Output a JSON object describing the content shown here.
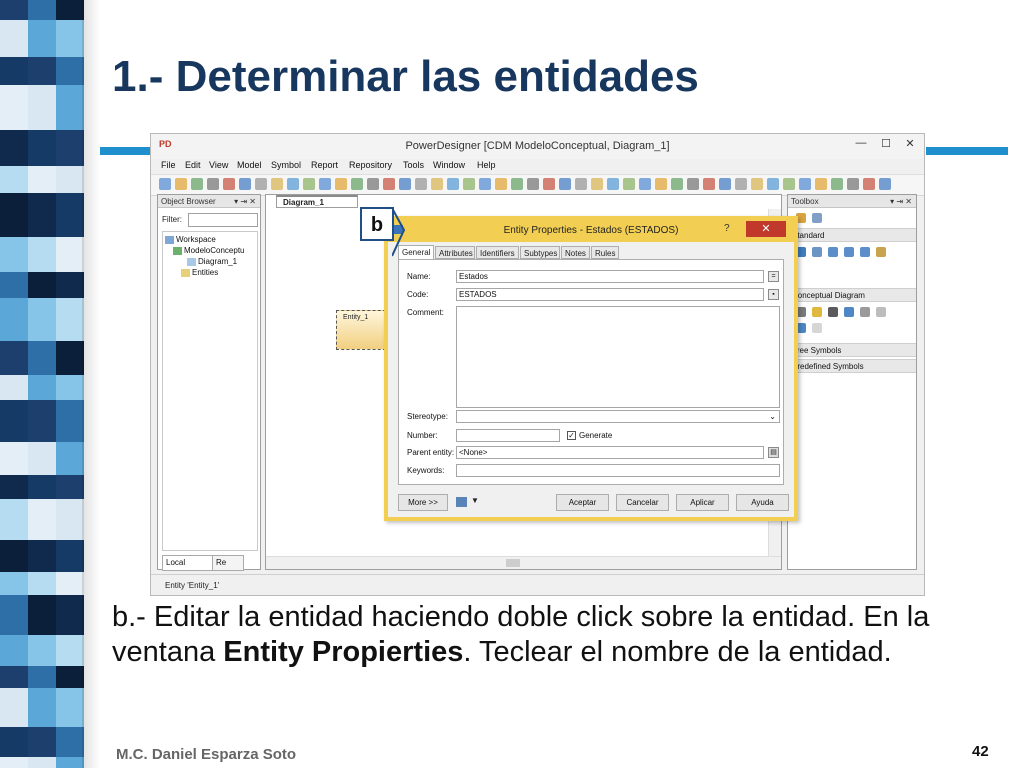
{
  "slide": {
    "title": "1.- Determinar las entidades",
    "caption_part1": "b.- Editar la entidad haciendo doble click sobre la entidad. En la ventana ",
    "caption_bold": "Entity Propierties",
    "caption_part2": ". Teclear el nombre de la entidad.",
    "footer": "M.C. Daniel Esparza Soto",
    "page_number": "42",
    "callout_label": "b",
    "colors": {
      "title": "#17375e",
      "accent_bar": "#1f8fce",
      "dialog_frame": "#f2cf52",
      "close_button": "#c0392b"
    }
  },
  "app": {
    "window_title": "PowerDesigner [CDM ModeloConceptual, Diagram_1]",
    "app_icon": "PD",
    "window_controls": {
      "minimize": "—",
      "maximize": "☐",
      "close": "✕"
    },
    "menu": [
      "File",
      "Edit",
      "View",
      "Model",
      "Symbol",
      "Report",
      "Repository",
      "Tools",
      "Window",
      "Help"
    ],
    "object_browser": {
      "title": "Object Browser",
      "pin": "▾ ⇥ ✕",
      "filter_label": "Filter:",
      "tree": [
        "Workspace",
        "ModeloConceptu",
        "Diagram_1",
        "Entities"
      ],
      "tabs": [
        "Local",
        "Re"
      ]
    },
    "diagram": {
      "tab": "Diagram_1",
      "entity_label": "Entity_1"
    },
    "toolbox": {
      "title": "Toolbox",
      "sections": [
        "Standard",
        "Conceptual Diagram",
        "Free Symbols",
        "Predefined Symbols"
      ]
    },
    "status_text": "Entity 'Entity_1'"
  },
  "dialog": {
    "title": "Entity Properties - Estados (ESTADOS)",
    "help_glyph": "?",
    "close_glyph": "✕",
    "tabs": [
      "General",
      "Attributes",
      "Identifiers",
      "Subtypes",
      "Notes",
      "Rules"
    ],
    "fields": {
      "name_label": "Name:",
      "name_value": "Estados",
      "code_label": "Code:",
      "code_value": "ESTADOS",
      "comment_label": "Comment:",
      "stereotype_label": "Stereotype:",
      "number_label": "Number:",
      "generate_label": "Generate",
      "parent_label": "Parent entity:",
      "parent_value": "<None>",
      "keywords_label": "Keywords:"
    },
    "buttons": {
      "more": "More >>",
      "accept": "Aceptar",
      "cancel": "Cancelar",
      "apply": "Aplicar",
      "help": "Ayuda"
    }
  }
}
